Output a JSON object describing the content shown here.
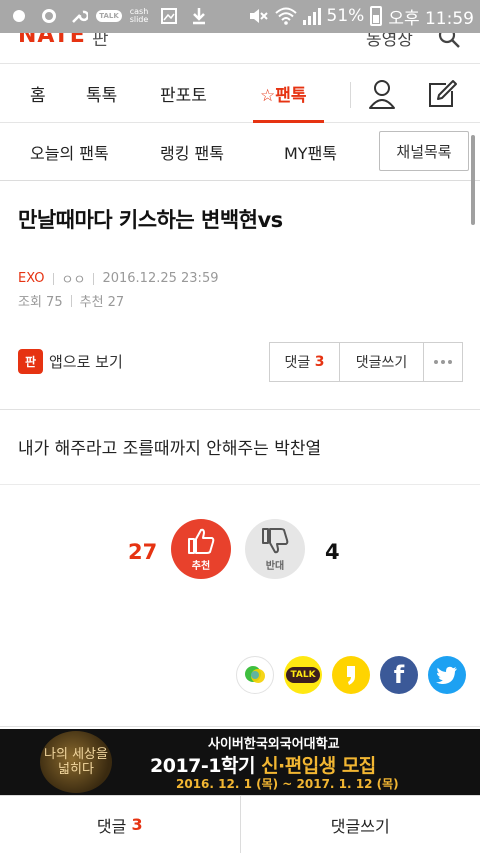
{
  "status_bar": {
    "time": "오후 11:59",
    "battery": "51%",
    "icons": [
      "notification-icon",
      "settings-icon",
      "wrench-icon",
      "talk-icon",
      "cashslide-icon",
      "gallery-icon",
      "download-icon",
      "mute-icon",
      "wifi-icon",
      "signal-icon",
      "battery-icon"
    ],
    "talk_label": "TALK",
    "cash_label": "cash slide"
  },
  "header": {
    "logo": "NATE",
    "logo_sub": "판",
    "link": "동영상",
    "search_icon": "search-icon"
  },
  "tabs": {
    "items": [
      {
        "label": "홈"
      },
      {
        "label": "톡톡"
      },
      {
        "label": "판포토"
      },
      {
        "label": "☆팬톡"
      }
    ],
    "active_index": 3,
    "user_icon": "user-icon",
    "write_icon": "write-icon"
  },
  "subtabs": {
    "items": [
      {
        "label": "오늘의 팬톡"
      },
      {
        "label": "랭킹 팬톡"
      },
      {
        "label": "MY팬톡"
      }
    ],
    "channel_button": "채널목록"
  },
  "article": {
    "title": "만날때마다 키스하는 변백현vs",
    "category": "EXO",
    "author": "ㅇㅇ",
    "datetime": "2016.12.25 23:59",
    "views_label": "조회 75",
    "recommend_label": "추천 27",
    "app_view_label": "앱으로 보기",
    "app_icon_text": "판",
    "comments_label": "댓글",
    "comments_count": "3",
    "write_comment_label": "댓글쓰기",
    "body": "내가 해주라고 조를때까지 안해주는 박찬열"
  },
  "votes": {
    "up_count": "27",
    "up_label": "추천",
    "down_count": "4",
    "down_label": "반대",
    "up_color": "#e8412c",
    "down_color": "#e6e6e6"
  },
  "share": {
    "items": [
      {
        "name": "line-share-icon",
        "color": "#ffffff"
      },
      {
        "name": "kakaotalk-share-icon",
        "color": "#ffe812",
        "label": "TALK"
      },
      {
        "name": "kakaostory-share-icon",
        "color": "#ffd400"
      },
      {
        "name": "facebook-share-icon",
        "color": "#3b5998",
        "label": "f"
      },
      {
        "name": "twitter-share-icon",
        "color": "#1da1f2"
      }
    ]
  },
  "ad": {
    "slogan": "나의 세상을 넓히다",
    "school": "사이버한국외국어대학교",
    "headline_prefix": "2017-1학기",
    "headline_highlight": "신·편입생 모집",
    "dates": "2016. 12. 1 (목) ~ 2017. 1. 12 (목)"
  },
  "bottom_bar": {
    "comments_label": "댓글",
    "comments_count": "3",
    "write_label": "댓글쓰기"
  },
  "colors": {
    "accent": "#e63312",
    "status_bar_bg": "#a8a8a8"
  }
}
